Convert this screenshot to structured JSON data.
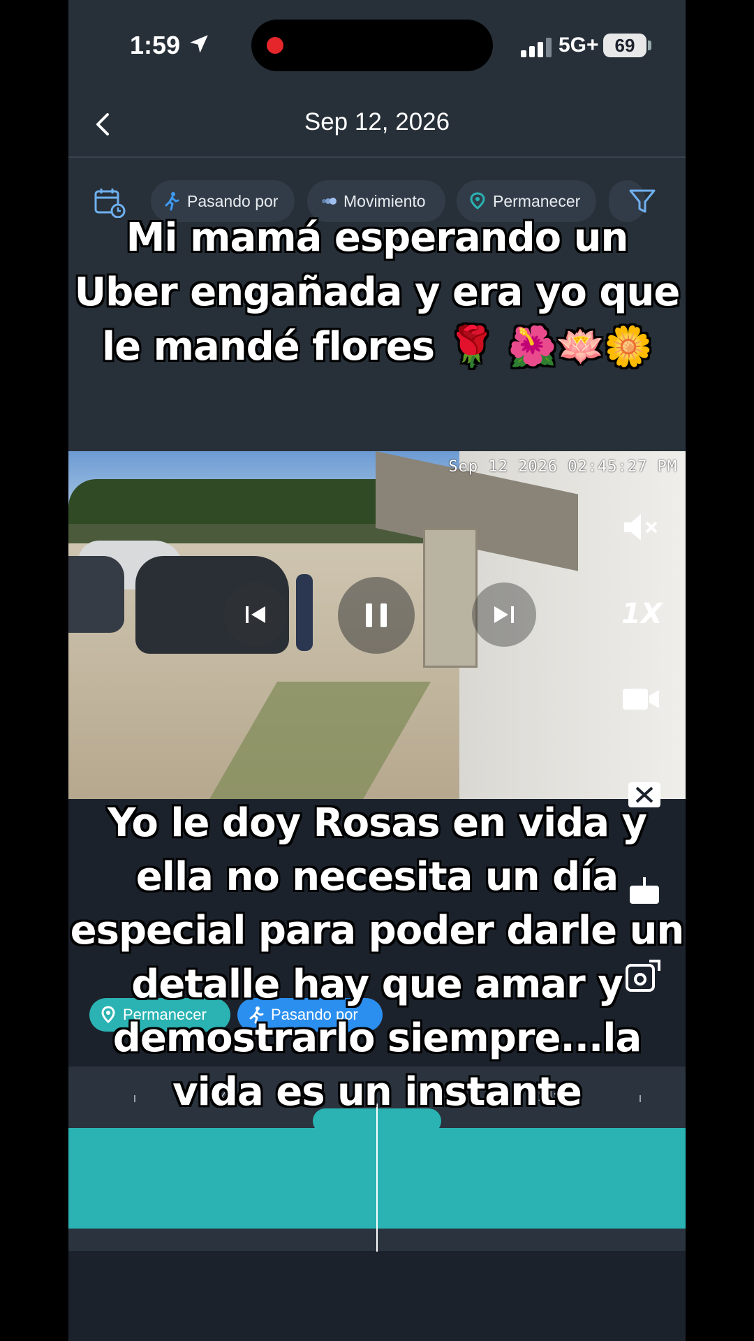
{
  "status_bar": {
    "time": "1:59",
    "network": "5G+",
    "battery": "69"
  },
  "header": {
    "title": "Sep 12, 2026"
  },
  "filters": {
    "chips": [
      "Pasando por",
      "Movimiento",
      "Permanecer"
    ]
  },
  "captions": {
    "top": "Mi mamá esperando  un Uber engañada y era yo que le mandé flores 🌹 🌺🪷🌼",
    "bottom": "Yo le doy Rosas en vida y ella no necesita un día especial para poder darle un detalle hay que amar y demostrarlo siempre...la vida es un instante"
  },
  "video": {
    "timestamp": "Sep 12 2026 02:45:27 PM",
    "speed": "1X"
  },
  "events": {
    "badges": [
      "Permanecer",
      "Pasando por"
    ]
  },
  "timeline": {
    "labels": [
      "14:45",
      "14:46"
    ]
  },
  "colors": {
    "accent_teal": "#2ab3b2",
    "accent_blue": "#2b8ff0",
    "background": "#1c222c",
    "header_bg": "#273039"
  }
}
